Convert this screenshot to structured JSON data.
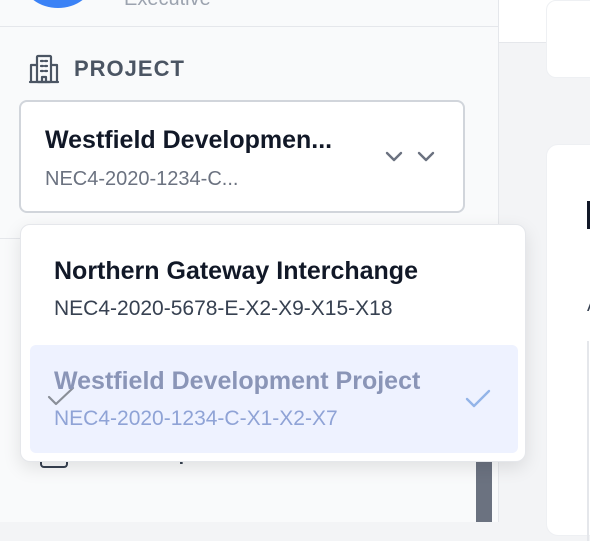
{
  "user": {
    "role": "Executive"
  },
  "sidebar": {
    "section_title": "PROJECT",
    "selected_project": {
      "name": "Westfield Developmen...",
      "code": "NEC4-2020-1234-C..."
    },
    "nav_partial_text": "p"
  },
  "dropdown": {
    "options": [
      {
        "name": "Northern Gateway Interchange",
        "code": "NEC4-2020-5678-E-X2-X9-X15-X18",
        "selected": false
      },
      {
        "name": "Westfield Development Project",
        "code": "NEC4-2020-1234-C-X1-X2-X7",
        "selected": true
      }
    ]
  },
  "colors": {
    "accent": "#3b82f6",
    "selected_bg": "#eef2ff",
    "check": "#93b4e8"
  },
  "icons": [
    "building-icon",
    "chevron-down-icon",
    "check-icon"
  ]
}
